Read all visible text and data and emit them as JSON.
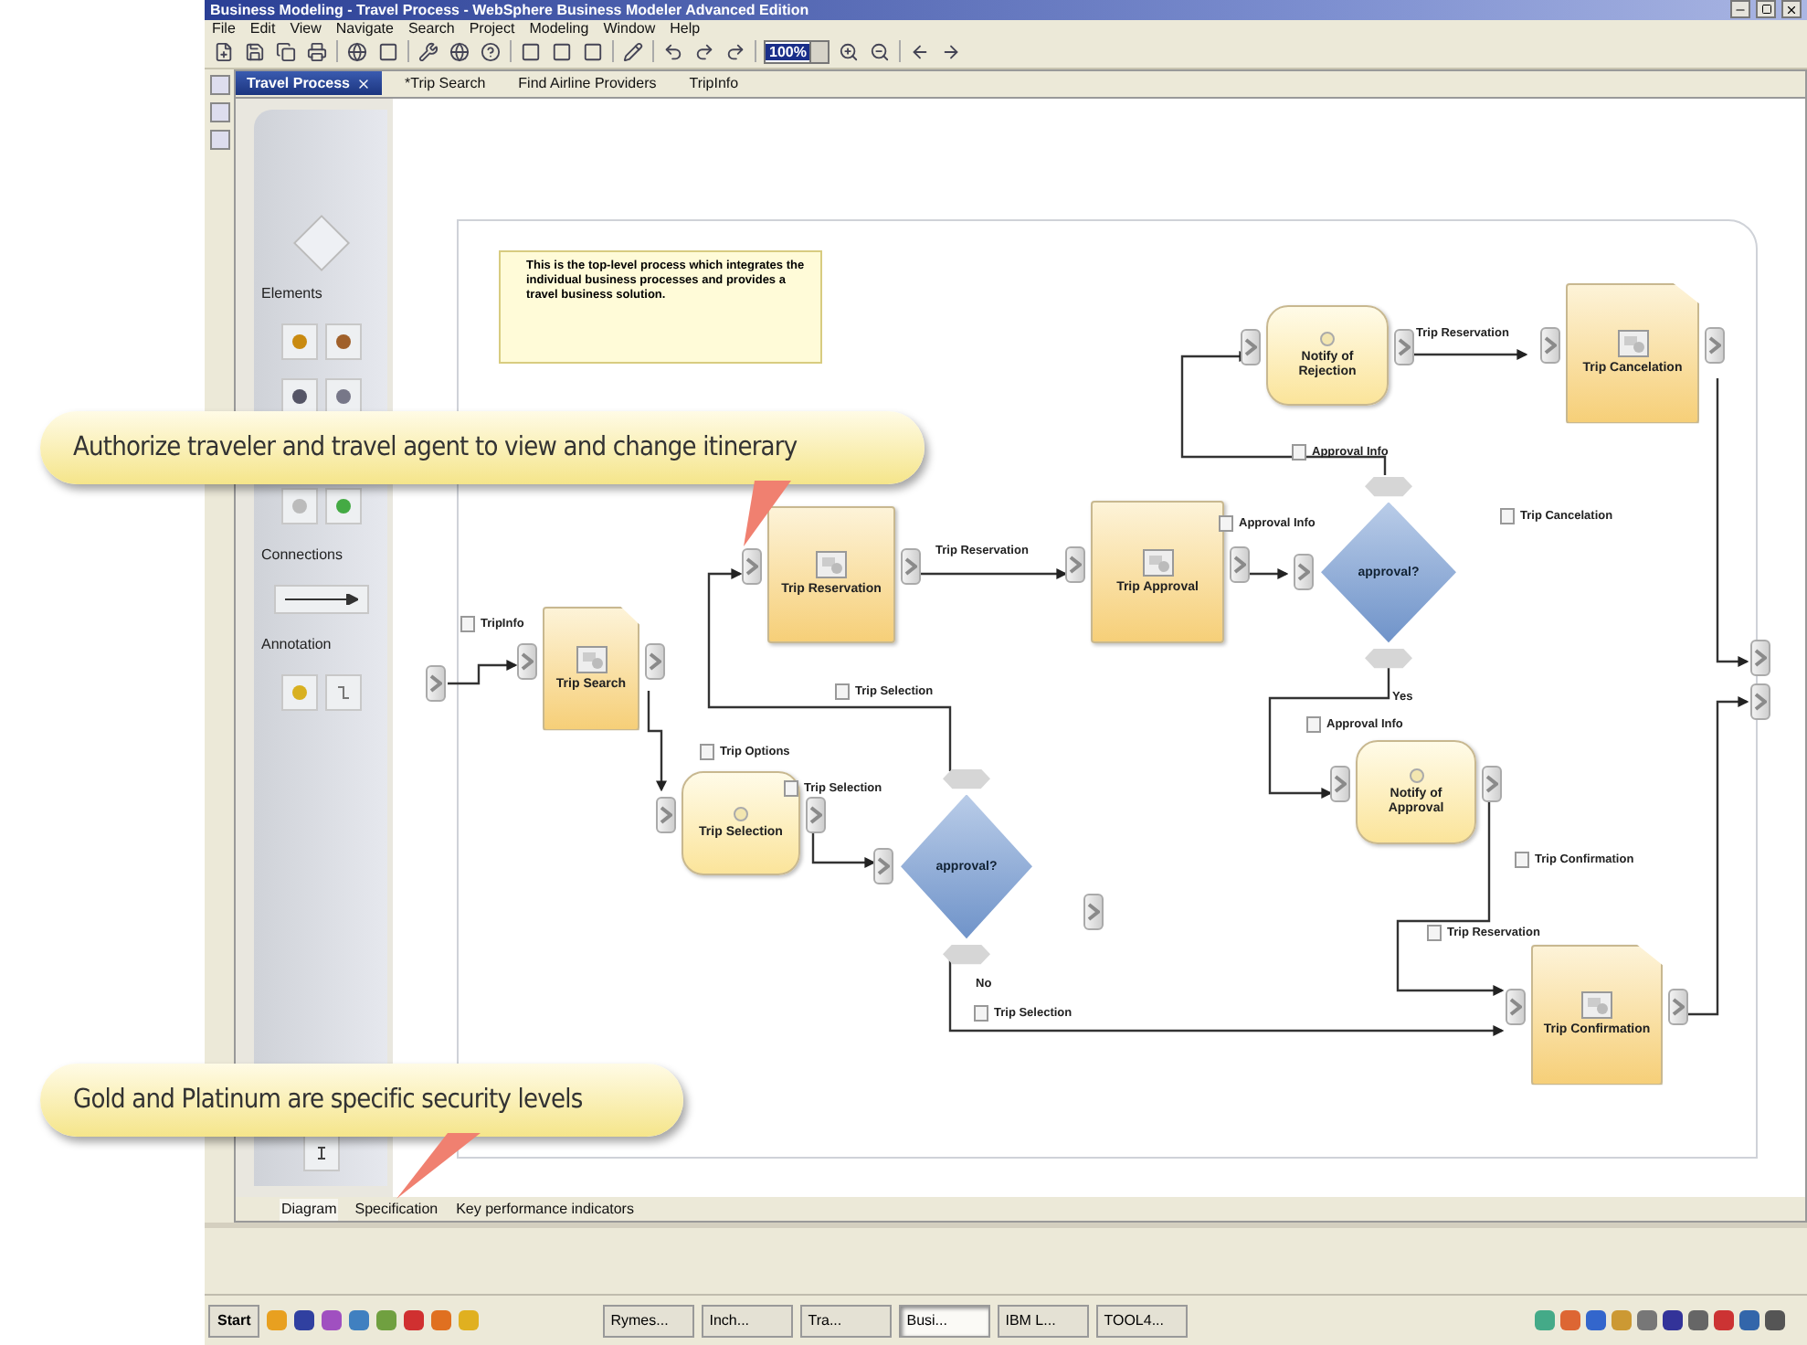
{
  "window": {
    "title": "Business Modeling - Travel Process - WebSphere Business Modeler Advanced Edition"
  },
  "menu": [
    "File",
    "Edit",
    "View",
    "Navigate",
    "Search",
    "Project",
    "Modeling",
    "Window",
    "Help"
  ],
  "toolbar": {
    "zoom": "100%"
  },
  "editor_tabs": [
    {
      "label": "Travel Process",
      "selected": true
    },
    {
      "label": "*Trip Search",
      "selected": false
    },
    {
      "label": "Find Airline Providers",
      "selected": false
    },
    {
      "label": "TripInfo",
      "selected": false
    }
  ],
  "palette": {
    "sections": [
      "Elements",
      "Connections",
      "Annotation"
    ]
  },
  "diagram": {
    "note": "This is the top-level process which integrates the individual business processes and provides a travel business solution.",
    "nodes": [
      {
        "kind": "subprocess",
        "label": "Trip Search"
      },
      {
        "kind": "task",
        "label": "Trip Reservation"
      },
      {
        "kind": "task",
        "label": "Trip Approval"
      },
      {
        "kind": "human",
        "label": "Notify of Rejection"
      },
      {
        "kind": "subprocess",
        "label": "Trip Cancelation"
      },
      {
        "kind": "decision",
        "label": "approval?"
      },
      {
        "kind": "human",
        "label": "Notify of Approval"
      },
      {
        "kind": "human",
        "label": "Trip Selection"
      },
      {
        "kind": "decision",
        "label": "approval?"
      },
      {
        "kind": "subprocess",
        "label": "Trip Confirmation"
      }
    ],
    "labels": [
      {
        "kind": "data",
        "text": "TripInfo"
      },
      {
        "kind": "plain",
        "text": "Trip Reservation"
      },
      {
        "kind": "data",
        "text": "Trip Options"
      },
      {
        "kind": "data",
        "text": "Trip Selection"
      },
      {
        "kind": "data",
        "text": "Trip Selection"
      },
      {
        "kind": "data",
        "text": "Approval Info"
      },
      {
        "kind": "data",
        "text": "Approval Info"
      },
      {
        "kind": "plain",
        "text": "Trip Reservation"
      },
      {
        "kind": "data",
        "text": "Trip Cancelation"
      },
      {
        "kind": "plain",
        "text": "Yes"
      },
      {
        "kind": "data",
        "text": "Approval Info"
      },
      {
        "kind": "plain",
        "text": "No"
      },
      {
        "kind": "data",
        "text": "Trip Selection"
      },
      {
        "kind": "data",
        "text": "Trip Confirmation"
      },
      {
        "kind": "data",
        "text": "Trip Reservation"
      }
    ]
  },
  "callouts": [
    "Authorize traveler and travel agent to view and change itinerary",
    "Gold and Platinum are specific security levels"
  ],
  "bottom_tabs": [
    {
      "label": "Diagram",
      "selected": true
    },
    {
      "label": "Specification",
      "selected": false
    },
    {
      "label": "Key performance indicators",
      "selected": false
    }
  ],
  "taskbar": {
    "start": "Start",
    "tasks": [
      {
        "label": "Rymes...",
        "selected": false
      },
      {
        "label": "Inch...",
        "selected": false
      },
      {
        "label": "Tra...",
        "selected": false
      },
      {
        "label": "Busi...",
        "selected": true
      },
      {
        "label": "IBM L...",
        "selected": false
      },
      {
        "label": "TOOL4...",
        "selected": false
      }
    ]
  }
}
